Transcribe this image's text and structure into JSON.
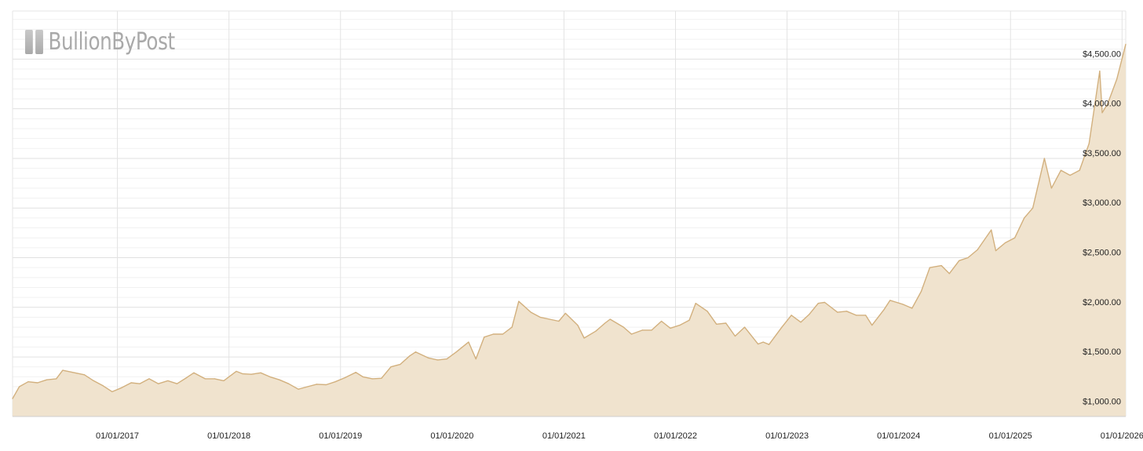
{
  "logo": {
    "text": "BullionByPost",
    "mark_icon": "gold-bar-icon",
    "color": "#a9a9a9"
  },
  "chart_data": {
    "type": "area",
    "title": "",
    "xlabel": "",
    "ylabel": "",
    "currency": "USD",
    "x_ticks": [
      "01/01/2017",
      "01/01/2018",
      "01/01/2019",
      "01/01/2020",
      "01/01/2021",
      "01/01/2022",
      "01/01/2023",
      "01/01/2024",
      "01/01/2025",
      "01/01/2026"
    ],
    "y_ticks": [
      1000,
      1500,
      2000,
      2500,
      3000,
      3500,
      4000,
      4500
    ],
    "y_tick_labels": [
      "$1,000.00",
      "$1,500.00",
      "$2,000.00",
      "$2,500.00",
      "$3,000.00",
      "$3,500.00",
      "$4,000.00",
      "$4,500.00"
    ],
    "xlim": [
      "2016-01-24",
      "2026-01-13"
    ],
    "ylim": [
      900,
      4985
    ],
    "grid": true,
    "legend": "none",
    "line_color": "#d2b07e",
    "fill_color": "#f0e3ce",
    "series": [
      {
        "x": [
          "2016-01-24",
          "2016-02-15",
          "2016-03-15",
          "2016-04-15",
          "2016-05-15",
          "2016-06-15",
          "2016-07-06",
          "2016-08-15",
          "2016-09-15",
          "2016-10-15",
          "2016-11-15",
          "2016-12-15",
          "2017-01-15",
          "2017-02-15",
          "2017-03-15",
          "2017-04-15",
          "2017-05-15",
          "2017-06-15",
          "2017-07-15",
          "2017-08-15",
          "2017-09-08",
          "2017-10-15",
          "2017-11-15",
          "2017-12-15",
          "2018-01-25",
          "2018-02-15",
          "2018-03-15",
          "2018-04-15",
          "2018-05-15",
          "2018-06-15",
          "2018-07-15",
          "2018-08-16",
          "2018-09-15",
          "2018-10-15",
          "2018-11-15",
          "2018-12-15",
          "2019-01-15",
          "2019-02-20",
          "2019-03-15",
          "2019-04-15",
          "2019-05-15",
          "2019-06-15",
          "2019-07-15",
          "2019-08-15",
          "2019-09-04",
          "2019-10-15",
          "2019-11-15",
          "2019-12-15",
          "2020-01-15",
          "2020-02-24",
          "2020-03-19",
          "2020-04-15",
          "2020-05-15",
          "2020-06-15",
          "2020-07-15",
          "2020-08-06",
          "2020-09-15",
          "2020-10-15",
          "2020-11-15",
          "2020-12-15",
          "2021-01-06",
          "2021-02-15",
          "2021-03-08",
          "2021-04-15",
          "2021-05-15",
          "2021-06-01",
          "2021-07-15",
          "2021-08-10",
          "2021-09-15",
          "2021-10-15",
          "2021-11-16",
          "2021-12-15",
          "2022-01-15",
          "2022-02-15",
          "2022-03-08",
          "2022-04-15",
          "2022-05-15",
          "2022-06-15",
          "2022-07-15",
          "2022-08-15",
          "2022-09-28",
          "2022-10-15",
          "2022-11-03",
          "2022-12-15",
          "2023-01-15",
          "2023-02-15",
          "2023-03-15",
          "2023-04-13",
          "2023-05-04",
          "2023-06-15",
          "2023-07-15",
          "2023-08-15",
          "2023-09-15",
          "2023-10-06",
          "2023-11-15",
          "2023-12-04",
          "2024-01-15",
          "2024-02-14",
          "2024-03-15",
          "2024-04-12",
          "2024-05-20",
          "2024-06-15",
          "2024-07-17",
          "2024-08-15",
          "2024-09-15",
          "2024-10-30",
          "2024-11-14",
          "2024-12-15",
          "2025-01-15",
          "2025-02-15",
          "2025-03-15",
          "2025-04-22",
          "2025-05-15",
          "2025-06-15",
          "2025-07-15",
          "2025-08-15",
          "2025-09-15",
          "2025-10-20",
          "2025-10-28",
          "2025-11-15",
          "2025-12-15",
          "2026-01-13"
        ],
        "values": [
          1080,
          1200,
          1250,
          1240,
          1270,
          1280,
          1365,
          1340,
          1320,
          1260,
          1210,
          1150,
          1190,
          1240,
          1230,
          1280,
          1230,
          1260,
          1230,
          1290,
          1340,
          1280,
          1280,
          1260,
          1355,
          1330,
          1325,
          1340,
          1300,
          1270,
          1230,
          1175,
          1200,
          1225,
          1220,
          1250,
          1290,
          1345,
          1300,
          1280,
          1285,
          1400,
          1425,
          1510,
          1550,
          1490,
          1470,
          1480,
          1550,
          1650,
          1480,
          1700,
          1730,
          1730,
          1800,
          2060,
          1950,
          1900,
          1880,
          1860,
          1940,
          1820,
          1690,
          1760,
          1840,
          1880,
          1800,
          1730,
          1770,
          1770,
          1860,
          1790,
          1820,
          1870,
          2040,
          1960,
          1830,
          1840,
          1710,
          1800,
          1630,
          1650,
          1625,
          1800,
          1920,
          1850,
          1930,
          2040,
          2050,
          1950,
          1960,
          1920,
          1920,
          1820,
          1980,
          2070,
          2030,
          1990,
          2160,
          2400,
          2420,
          2340,
          2470,
          2500,
          2580,
          2780,
          2570,
          2650,
          2700,
          2900,
          3000,
          3500,
          3200,
          3380,
          3330,
          3380,
          3650,
          4380,
          3960,
          4050,
          4300,
          4650
        ]
      }
    ]
  }
}
